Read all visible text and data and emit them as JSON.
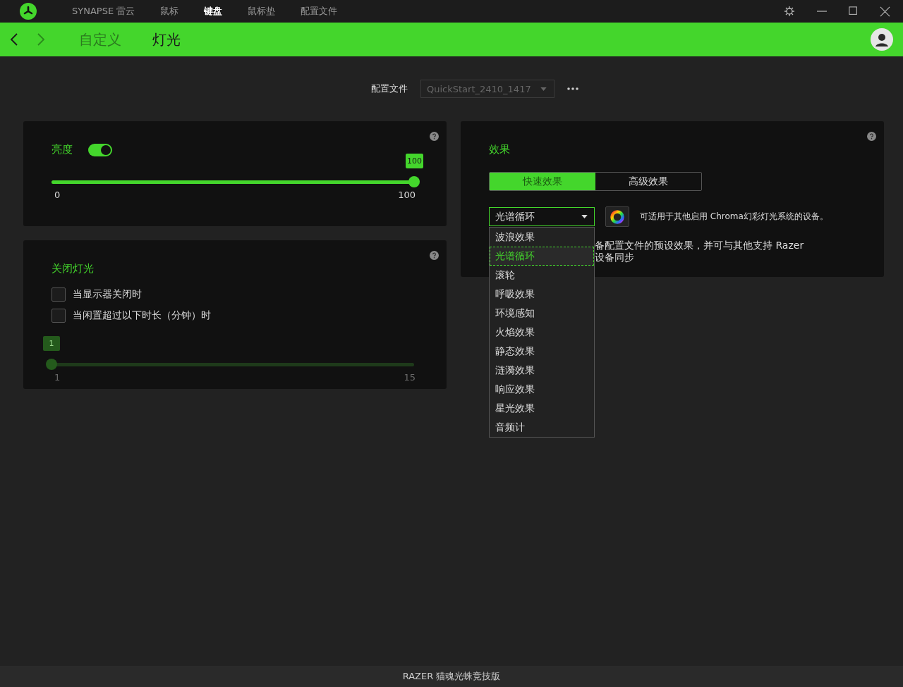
{
  "nav": {
    "tabs": [
      {
        "label": "SYNAPSE 雷云",
        "selected": false
      },
      {
        "label": "鼠标",
        "selected": false
      },
      {
        "label": "键盘",
        "selected": true
      },
      {
        "label": "鼠标垫",
        "selected": false
      },
      {
        "label": "配置文件",
        "selected": false
      }
    ]
  },
  "subnav": {
    "tabs": [
      {
        "label": "自定义",
        "selected": false
      },
      {
        "label": "灯光",
        "selected": true
      }
    ]
  },
  "profile": {
    "label": "配置文件",
    "value": "QuickStart_2410_1417",
    "disabled": true
  },
  "brightness": {
    "title": "亮度",
    "on": true,
    "level": 1,
    "value_badge": "100",
    "min": "0",
    "max": "100"
  },
  "lights_off": {
    "title": "关闭灯光",
    "options": [
      {
        "label": "当显示器关闭时",
        "checked": false
      },
      {
        "label": "当闲置超过以下时长（分钟）时",
        "checked": false
      }
    ],
    "slider": {
      "disabled": true,
      "level": 0,
      "value_badge": "1",
      "min": "1",
      "max": "15"
    }
  },
  "effects": {
    "title": "效果",
    "tabs": [
      {
        "label": "快速效果",
        "selected": true
      },
      {
        "label": "高级效果",
        "selected": false
      }
    ],
    "dropdown": {
      "value": "光谱循环",
      "expanded": true,
      "options": [
        {
          "label": "波浪效果",
          "selected": false
        },
        {
          "label": "光谱循环",
          "selected": true
        },
        {
          "label": "滚轮",
          "selected": false
        },
        {
          "label": "呼吸效果",
          "selected": false
        },
        {
          "label": "环境感知",
          "selected": false
        },
        {
          "label": "火焰效果",
          "selected": false
        },
        {
          "label": "静态效果",
          "selected": false
        },
        {
          "label": "涟漪效果",
          "selected": false
        },
        {
          "label": "响应效果",
          "selected": false
        },
        {
          "label": "星光效果",
          "selected": false
        },
        {
          "label": "音频计",
          "selected": false
        }
      ]
    },
    "chroma_note": "可适用于其他启用 Chroma幻彩灯光系统的设备。",
    "description_lines": [
      "备配置文件的预设效果，并可与其他支持 Razer",
      "设备同步"
    ]
  },
  "status_bar": "RAZER 猫魂光蛛竞技版"
}
